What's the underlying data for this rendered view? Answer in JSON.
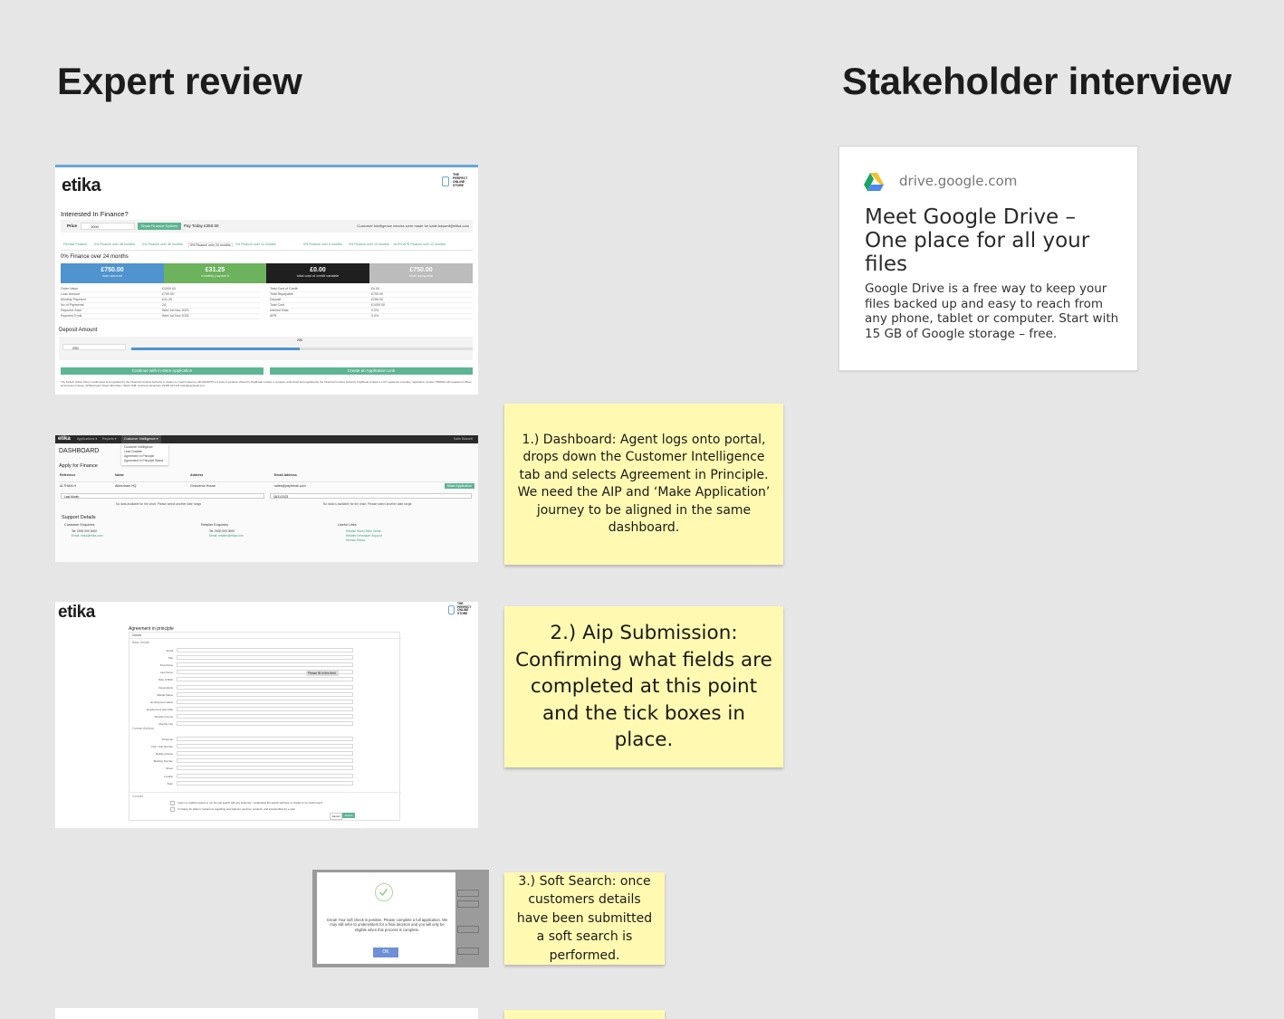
{
  "headings": {
    "expert_review": "Expert review",
    "stakeholder_interview": "Stakeholder interview"
  },
  "google_card": {
    "domain": "drive.google.com",
    "title": "Meet Google Drive – One place for all your files",
    "description": "Google Drive is a free way to keep your files backed up and easy to reach from any phone, tablet or computer. Start with 15 GB of Google storage – free."
  },
  "stickies": {
    "note1": "1.) Dashboard: Agent logs onto portal, drops down the Customer Intelligence tab and selects Agreement in Principle. We need the AIP and ‘Make Application’ journey to be aligned in the same dashboard.",
    "note2": "2.) Aip Submission: Confirming what fields are completed at this point and the tick boxes in place.",
    "note3": "3.) Soft Search: once customers details have been submitted a soft search is performed."
  },
  "shot1": {
    "logo": "etika",
    "store": "THE PERFECT ONLINE STORE",
    "heading": "Interested In Finance?",
    "price_label": "Price",
    "price_value": "1000",
    "show_options": "Show Finance Options",
    "pay_today": "Pay Today £350.00",
    "ci_note": "Customer Intelligence checks were made for katie.bassett@etika.com",
    "tabs": [
      "Flexible Finance",
      "0% Finance over 48 months",
      "0% Finance over 36 months",
      "0% Finance over 24 months",
      "0% Finance over 12 months",
      "0% Finance over 6 months",
      "0% Finance over 10 months",
      "18.9% APR Finance over 12 months"
    ],
    "section": "0% Finance over 24 months",
    "tiles": [
      {
        "value": "£750.00",
        "label": "loan amount",
        "color": "#4f93cf"
      },
      {
        "value": "£31.25",
        "label": "monthly payment",
        "color": "#6db25d"
      },
      {
        "value": "£0.00",
        "label": "total cost of credit variable",
        "color": "#1f1f1f"
      },
      {
        "value": "£750.00",
        "label": "total repayable",
        "color": "#bcbcbc"
      }
    ],
    "details_left": [
      "Order Value",
      "Loan Amount",
      "Monthly Payment",
      "No of Payments",
      "Payment Start",
      "Payment Ends"
    ],
    "details_left_vals": [
      "£1000.00",
      "£750.00",
      "£31.25",
      "24",
      "Wed 1st Nov 2023",
      "Wed 1st Nov 2025"
    ],
    "details_right": [
      "Total Cost of Credit",
      "Total Repayable",
      "Deposit",
      "Total Cost",
      "Interest Rate",
      "APR"
    ],
    "details_right_vals": [
      "£0.00",
      "£750.00",
      "£250.00",
      "£1000.00",
      "0.0%",
      "0.0%"
    ],
    "deposit": "Deposit Amount",
    "deposit_value": "250",
    "slider_label": "250",
    "continue_btn": "Continue with in-store Application",
    "link_btn": "Create an Application Link",
    "footer": "The Perfect Online Store is authorised and regulated by the Financial Conduct Authority in relation to credit brokering. etFinish/ETIN is a suite of products offered by PayBreak Limited, a company authorised and regulated by the Financial Conduct Authority. PayBreak Limited is a UK registered company, registration number 7995932 with registered offices at Grosvenor House, 20 Barrington Road, Altrincham, WA14 1HB. Customer Enquiries: 03330 444 224 hello@paybreak.com"
  },
  "shot2": {
    "nav": [
      "Applications ▾",
      "Reports ▾",
      "Customer Intelligence ▾"
    ],
    "nav_user": "Katie Bassett",
    "dropdown": [
      "Customer Intelligence",
      "Lead Grabber",
      "Agreement in Principle",
      "Agreement in Principle Status"
    ],
    "title": "DASHBOARD",
    "subtitle": "Apply for Finance",
    "cols": [
      "Reference",
      "Name",
      "Address",
      "Email Address"
    ],
    "row": [
      "ALTHAM-H",
      "Altrincham HQ",
      "Grosvenor House",
      "sales@paybreak.com"
    ],
    "make_app": "Make Application",
    "select1": "Last Month",
    "select2": "08/11/2023",
    "no_data1": "No data available for the chart. Please select another date range.",
    "no_data2": "No data is available for the chart. Please select another date range.",
    "support": "Support Details",
    "customer_enq": "Customer Enquiries",
    "customer_tel": "Tel: 0000 000 0000",
    "customer_email": "Email: hello@etika.com",
    "retailer_enq": "Retailer Enquiries",
    "retailer_tel": "Tel: 0000 000 0000",
    "retailer_email": "Email: retailer@etika.com",
    "useful": "Useful Links",
    "links": [
      "Retailer Back Office Guide",
      "Retailer Developer Support",
      "Service Status"
    ]
  },
  "shot3": {
    "logo": "etika",
    "title": "Agreement in principle",
    "tab": "Details",
    "section1": "Basic Details",
    "fields1": [
      "Email",
      "Title",
      "First Name",
      "Last Name",
      "Date of Birth",
      "Dependents",
      "Marital Status",
      "Employment status",
      "Employment start date",
      "Monthly Income",
      "Monthly Out"
    ],
    "tooltip": "Please fill in this field.",
    "section2": "Contact Address",
    "fields2": [
      "Postcode",
      "Flat / Unit Number",
      "Building Name",
      "Building Number",
      "Street",
      "Locality",
      "Town"
    ],
    "section3": "Consent",
    "consent1": "I give my explicit consent to run the soft search with any lender(s). I understand the search will have no impact to my credit report.",
    "consent2": "I'm happy for etika to contact me regarding new features, services, products, and special offers by e-mail.",
    "cancel": "Cancel",
    "submit": "Submit"
  },
  "shot4": {
    "message": "Great! Your soft check is positive. Please complete a full application. We may still refer to underwriters for a final decision and you will only be eligible when this process is complete.",
    "ok": "OK"
  }
}
